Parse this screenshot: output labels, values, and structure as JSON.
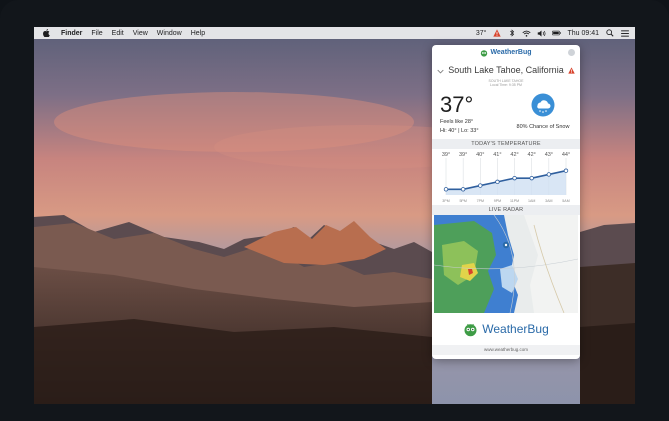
{
  "menubar": {
    "app_name": "Finder",
    "menus": [
      "File",
      "Edit",
      "View",
      "Window",
      "Help"
    ],
    "status_temp": "37°",
    "clock": "Thu 09:41"
  },
  "popover": {
    "brand": "WeatherBug",
    "location": "South Lake Tahoe, California",
    "station": "SOUTH LAKE TAHOE",
    "local_time": "Local Time: 9:35 PM",
    "current": {
      "temp": "37°",
      "feels_like": "Feels like 28°",
      "hi_lo": "Hi: 40° | Lo: 33°",
      "precip": "80% Chance of Snow"
    },
    "today_title": "TODAY'S TEMPERATURE",
    "radar_title": "LIVE RADAR",
    "footer_brand": "WeatherBug",
    "url": "www.weatherbug.com"
  },
  "chart_data": {
    "type": "line",
    "title": "TODAY'S TEMPERATURE",
    "categories": [
      "3PM",
      "5PM",
      "7PM",
      "9PM",
      "11PM",
      "1AM",
      "3AM",
      "5AM"
    ],
    "series": [
      {
        "values": [
          39,
          39,
          40,
          41,
          42,
          42,
          43,
          44
        ]
      }
    ],
    "value_labels": [
      "39°",
      "39°",
      "40°",
      "41°",
      "42°",
      "42°",
      "43°",
      "44°"
    ],
    "ylim": [
      38,
      45
    ],
    "grid": true,
    "colors": {
      "line": "#2f5f9e",
      "fill": "#cfe0f3"
    }
  },
  "colors": {
    "brand": "#2a6aa8",
    "alert": "#d8432c",
    "snow_icon": "#3a8fd6"
  }
}
